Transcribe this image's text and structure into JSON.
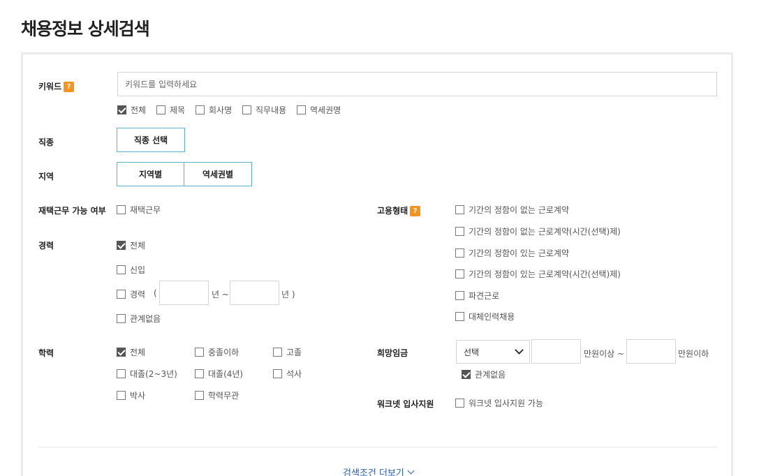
{
  "page": {
    "title": "채용정보 상세검색"
  },
  "keyword": {
    "label": "키워드",
    "help": "?",
    "placeholder": "키워드를 입력하세요",
    "options": [
      {
        "label": "전체",
        "checked": true
      },
      {
        "label": "제목",
        "checked": false
      },
      {
        "label": "회사명",
        "checked": false
      },
      {
        "label": "직무내용",
        "checked": false
      },
      {
        "label": "역세권명",
        "checked": false
      }
    ]
  },
  "job_type": {
    "label": "직종",
    "button": "직종 선택"
  },
  "region": {
    "label": "지역",
    "by_region": "지역별",
    "by_station": "역세권별"
  },
  "remote": {
    "label": "재택근무 가능 여부",
    "option": "재택근무",
    "checked": false
  },
  "career": {
    "label": "경력",
    "all": "전체",
    "newbie": "신입",
    "experienced": "경력",
    "open_paren": "(",
    "years_from": "년 ~",
    "years_to": "년 )",
    "any": "관계없음"
  },
  "education": {
    "label": "학력",
    "options": [
      {
        "label": "전체",
        "checked": true
      },
      {
        "label": "중졸이하",
        "checked": false
      },
      {
        "label": "고졸",
        "checked": false
      },
      {
        "label": "대졸(2~3년)",
        "checked": false
      },
      {
        "label": "대졸(4년)",
        "checked": false
      },
      {
        "label": "석사",
        "checked": false
      },
      {
        "label": "박사",
        "checked": false
      },
      {
        "label": "학력무관",
        "checked": false
      }
    ]
  },
  "employment": {
    "label": "고용형태",
    "help": "?",
    "options": [
      {
        "label": "기간의 정함이 없는 근로계약",
        "checked": false
      },
      {
        "label": "기간의 정함이 없는 근로계약(시간(선택)제)",
        "checked": false
      },
      {
        "label": "기간의 정함이 있는 근로계약",
        "checked": false
      },
      {
        "label": "기간의 정함이 있는 근로계약(시간(선택)제)",
        "checked": false
      },
      {
        "label": "파견근로",
        "checked": false
      },
      {
        "label": "대체인력채용",
        "checked": false
      }
    ]
  },
  "salary": {
    "label": "희망임금",
    "select_value": "선택",
    "min_suffix": "만원이상 ~",
    "max_suffix": "만원이하",
    "any": "관계없음",
    "any_checked": true
  },
  "worknet": {
    "label": "워크넷 입사지원",
    "option": "워크넷 입사지원 가능",
    "checked": false
  },
  "more": {
    "label": "검색조건 더보기"
  }
}
